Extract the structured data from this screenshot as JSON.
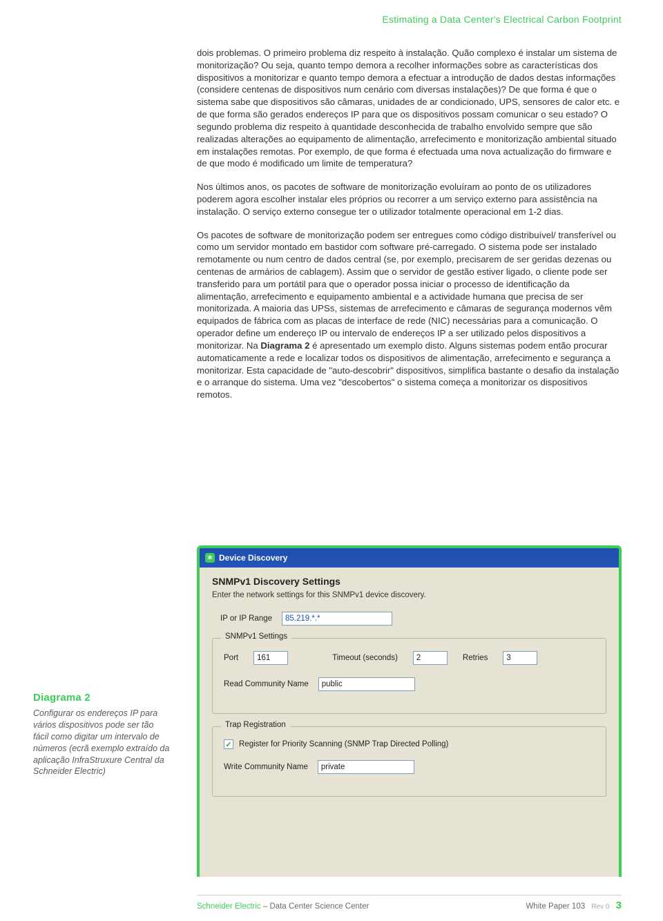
{
  "header": {
    "title": "Estimating a Data Center's Electrical Carbon Footprint"
  },
  "paragraphs": {
    "p1": "dois problemas. O primeiro problema diz respeito à instalação. Quão complexo é instalar um sistema de monitorização? Ou seja, quanto tempo demora a recolher informações sobre as características dos dispositivos a monitorizar e quanto tempo demora a efectuar a introdução de dados destas informações (considere centenas de dispositivos num cenário com diversas instalações)? De que forma é que o sistema sabe que dispositivos são câmaras, unidades de ar condicionado, UPS, sensores de calor etc. e de que forma são gerados endereços IP para que os dispositivos possam comunicar o seu estado? O segundo problema diz respeito à quantidade desconhecida de trabalho envolvido sempre que são realizadas alterações ao equipamento de alimentação, arrefecimento e monitorização ambiental situado em instalações remotas. Por exemplo, de que forma é efectuada uma nova actualização do firmware e de que modo é modificado um limite de temperatura?",
    "p2": "Nos últimos anos, os pacotes de software de monitorização evoluíram ao ponto de os utilizadores poderem agora escolher instalar eles próprios ou recorrer a um serviço externo para assistência na instalação. O serviço externo consegue ter o utilizador totalmente operacional em 1-2 dias.",
    "p3a": "Os pacotes de software de monitorização podem ser entregues como código distribuível/ transferível ou como um servidor montado em bastidor com software pré-carregado. O sistema pode ser instalado remotamente ou num centro de dados central (se, por exemplo, precisarem de ser geridas dezenas ou centenas de armários de cablagem). Assim que o servidor de gestão estiver ligado, o cliente pode ser transferido para um portátil para que o operador possa iniciar o processo de identificação da alimentação, arrefecimento e equipamento ambiental e a actividade humana que precisa de ser monitorizada. A maioria das UPSs, sistemas de arrefecimento e câmaras de segurança modernos vêm equipados de fábrica com as placas de interface de rede (NIC) necessárias para a comunicação. O operador define um endereço IP ou intervalo de endereços IP a ser utilizado pelos dispositivos a monitorizar. Na ",
    "p3_bold": "Diagrama 2",
    "p3b": " é apresentado um exemplo disto. Alguns sistemas podem então procurar automaticamente a rede e localizar todos os dispositivos de alimentação, arrefecimento e segurança a monitorizar. Esta capacidade de \"auto-descobrir\" dispositivos, simplifica bastante o desafio da instalação e o arranque do sistema. Uma vez \"descobertos\" o sistema começa a monitorizar os dispositivos remotos."
  },
  "caption": {
    "title": "Diagrama 2",
    "body": "Configurar os endereços IP para vários dispositivos pode ser tão fácil como digitar um intervalo de números (ecrã exemplo extraído da aplicação InfraStruxure Central da Schneider Electric)"
  },
  "dialog": {
    "title": "Device Discovery",
    "section_heading": "SNMPv1 Discovery Settings",
    "section_sub": "Enter the network settings for this SNMPv1 device discovery.",
    "ip_label": "IP or IP Range",
    "ip_value": "85.219.*.*",
    "snmp_legend": "SNMPv1 Settings",
    "port_label": "Port",
    "port_value": "161",
    "timeout_label": "Timeout (seconds)",
    "timeout_value": "2",
    "retries_label": "Retries",
    "retries_value": "3",
    "read_comm_label": "Read Community Name",
    "read_comm_value": "public",
    "trap_legend": "Trap Registration",
    "trap_chk_label": "Register for Priority Scanning (SNMP Trap Directed Polling)",
    "write_comm_label": "Write Community Name",
    "write_comm_value": "private"
  },
  "footer": {
    "brand": "Schneider Electric",
    "dash": " – ",
    "center": "Data Center Science Center",
    "wp": "White Paper 103",
    "rev": "Rev 0",
    "page": "3"
  }
}
